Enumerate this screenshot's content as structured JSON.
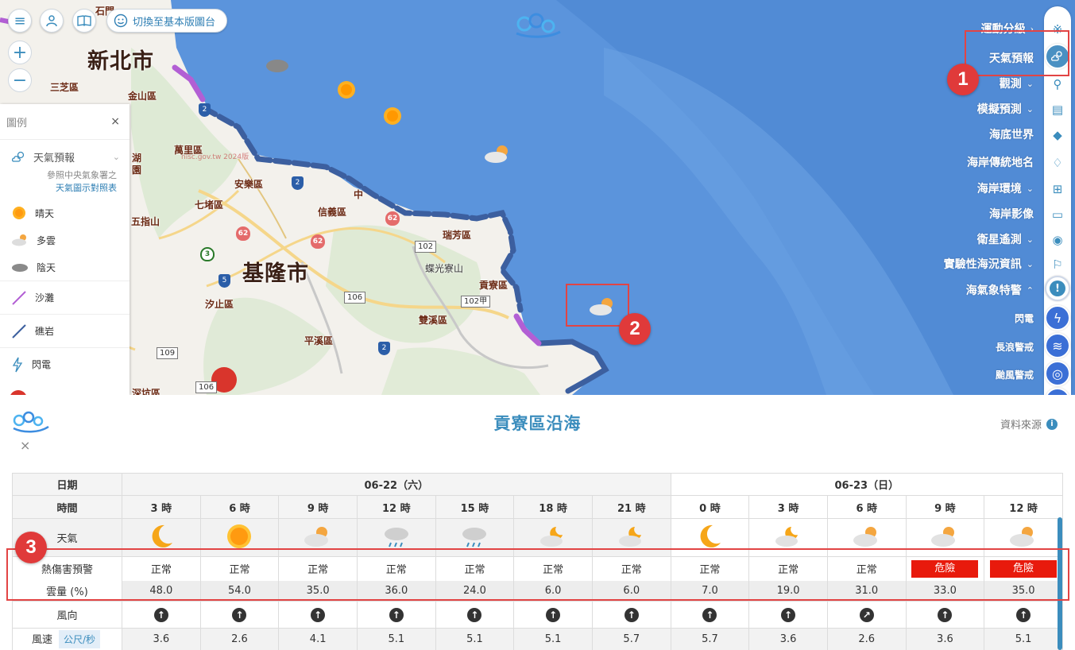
{
  "top_controls": {
    "switch_label": "切換至基本版圖台"
  },
  "map": {
    "cities": [
      "新北市",
      "基隆市"
    ],
    "districts": [
      "石門",
      "三芝區",
      "金山區",
      "萬里區",
      "安樂區",
      "七堵區",
      "信義區",
      "中",
      "瑞芳區",
      "五指山",
      "汐止區",
      "貢寮區",
      "雙溪區",
      "平溪區",
      "深坑區",
      "蝶光寮山",
      "湖",
      "園"
    ],
    "roads": [
      "102",
      "106",
      "102甲",
      "109",
      "106"
    ],
    "highways": [
      "62",
      "62",
      "62",
      "3"
    ],
    "national_highways": [
      "2",
      "5",
      "2",
      "2"
    ],
    "watermark": "nlsc.gov.tw 2024版"
  },
  "legend": {
    "title": "圖例",
    "close": "×",
    "section": "天氣預報",
    "note_line1": "參照中央氣象署之",
    "note_link": "天氣圖示對照表",
    "items": [
      {
        "icon": "sunny-icon",
        "label": "晴天"
      },
      {
        "icon": "cloudy-icon",
        "label": "多雲"
      },
      {
        "icon": "overcast-icon",
        "label": "陰天"
      },
      {
        "icon": "beach-line-icon",
        "label": "沙灘",
        "color": "#b25fd4"
      },
      {
        "icon": "reef-line-icon",
        "label": "礁岩",
        "color": "#3c5f9f"
      },
      {
        "icon": "lightning-icon",
        "label": "閃電"
      }
    ]
  },
  "right_menu": {
    "items": [
      {
        "label": "運動分級",
        "chev": "›"
      },
      {
        "label": "天氣預報",
        "chev": ""
      },
      {
        "label": "觀測",
        "chev": "⌄"
      },
      {
        "label": "模擬預測",
        "chev": "⌄"
      },
      {
        "label": "海底世界",
        "chev": ""
      },
      {
        "label": "海岸傳統地名",
        "chev": ""
      },
      {
        "label": "海岸環境",
        "chev": "⌄"
      },
      {
        "label": "海岸影像",
        "chev": ""
      },
      {
        "label": "衛星遙測",
        "chev": "⌄"
      },
      {
        "label": "實驗性海況資訊",
        "chev": "⌄"
      },
      {
        "label": "海氣象特警",
        "chev": "⌃"
      },
      {
        "label": "閃電",
        "chev": ""
      },
      {
        "label": "長浪警戒",
        "chev": ""
      },
      {
        "label": "颱風警戒",
        "chev": ""
      }
    ]
  },
  "annotations": [
    "1",
    "2",
    "3"
  ],
  "panel": {
    "title": "貢寮區沿海",
    "source": "資料來源",
    "close": "×",
    "table": {
      "date_label": "日期",
      "time_label": "時間",
      "dates": [
        "06-22（六）",
        "06-23（日）"
      ],
      "times": [
        "3 時",
        "6 時",
        "9 時",
        "12 時",
        "15 時",
        "18 時",
        "21 時",
        "0 時",
        "3 時",
        "6 時",
        "9 時",
        "12 時"
      ],
      "weather_label": "天氣",
      "weather": [
        "moon",
        "sun",
        "cloud-sun",
        "rain",
        "rain",
        "cloud-moon",
        "cloud-moon",
        "moon",
        "cloud-moon",
        "cloud-sun",
        "cloud-sun",
        "cloud-sun"
      ],
      "heat_label": "熱傷害預警",
      "heat": [
        "正常",
        "正常",
        "正常",
        "正常",
        "正常",
        "正常",
        "正常",
        "正常",
        "正常",
        "正常",
        "危險",
        "危險"
      ],
      "cloud_label": "雲量 (%)",
      "cloud": [
        "48.0",
        "54.0",
        "35.0",
        "36.0",
        "24.0",
        "6.0",
        "6.0",
        "7.0",
        "19.0",
        "31.0",
        "33.0",
        "35.0"
      ],
      "wind_dir_label": "風向",
      "wind_dir": [
        "↑",
        "↑",
        "↑",
        "↑",
        "↑",
        "↑",
        "↑",
        "↑",
        "↑",
        "↗",
        "↑",
        "↑"
      ],
      "wind_speed_label": "風速",
      "wind_speed_unit": "公尺/秒",
      "wind_speed": [
        "3.6",
        "2.6",
        "4.1",
        "5.1",
        "5.1",
        "5.1",
        "5.7",
        "5.7",
        "3.6",
        "2.6",
        "3.6",
        "5.1"
      ]
    }
  },
  "colors": {
    "accent": "#3b8dbd",
    "danger": "#e81a0c",
    "annotation": "#e24444",
    "sea": "#5a93dc"
  }
}
